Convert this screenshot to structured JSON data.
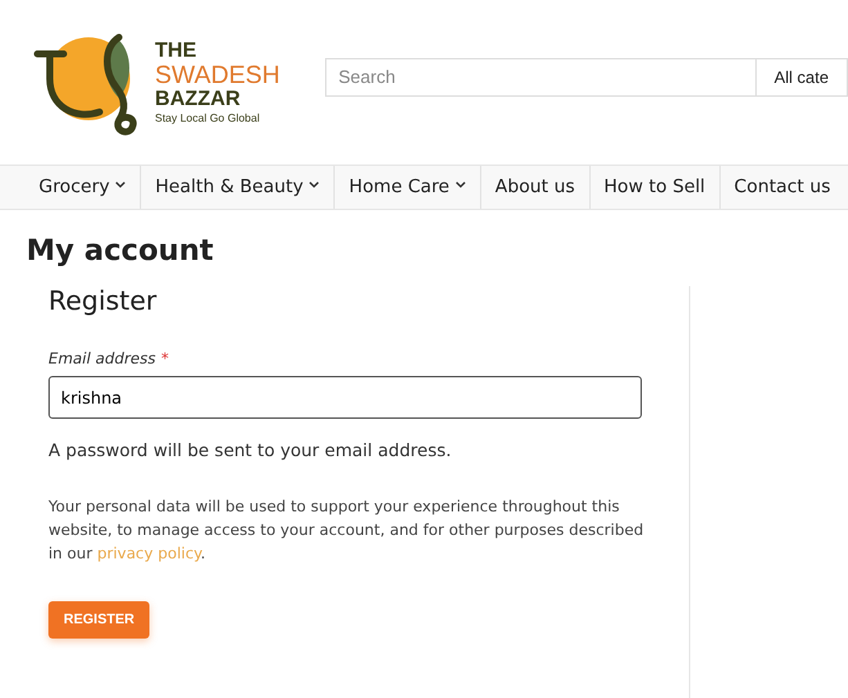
{
  "logo": {
    "line_1": "THE",
    "line_2": "SWADESH",
    "line_3": "BAZZAR",
    "tagline": "Stay Local Go Global"
  },
  "search": {
    "placeholder": "Search",
    "category": "All cate"
  },
  "nav": [
    {
      "label": "Grocery",
      "has_dropdown": true
    },
    {
      "label": "Health & Beauty",
      "has_dropdown": true
    },
    {
      "label": "Home Care",
      "has_dropdown": true
    },
    {
      "label": "About us",
      "has_dropdown": false
    },
    {
      "label": "How to Sell",
      "has_dropdown": false
    },
    {
      "label": "Contact us",
      "has_dropdown": false
    }
  ],
  "page_title": "My account",
  "register": {
    "heading": "Register",
    "email_label": "Email address",
    "required_mark": "*",
    "email_value": "krishna",
    "password_note": "A password will be sent to your email address.",
    "privacy_text_before": "Your personal data will be used to support your experience throughout this website, to manage access to your account, and for other purposes described in our",
    "privacy_link": "privacy policy",
    "privacy_text_after": ".",
    "button": "REGISTER"
  }
}
